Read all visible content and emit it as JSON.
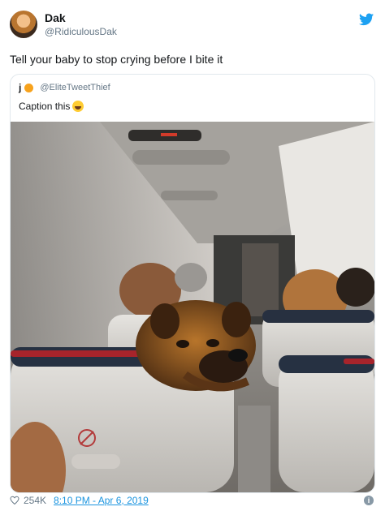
{
  "tweet": {
    "name": "Dak",
    "handle": "@RidiculousDak",
    "text": "Tell your baby to stop crying before I bite it",
    "likes": "254K",
    "timestamp": "8:10 PM - Apr 6, 2019"
  },
  "quoted": {
    "name": "j",
    "handle": "@EliteTweetThief",
    "text": "Caption this"
  },
  "icons": {
    "brand": "twitter-bird-icon",
    "like": "heart-icon",
    "info": "info-icon",
    "emoji": "tears-of-joy-emoji"
  },
  "colors": {
    "link": "#1b95e0",
    "brand": "#1da1f2",
    "muted": "#657786"
  }
}
